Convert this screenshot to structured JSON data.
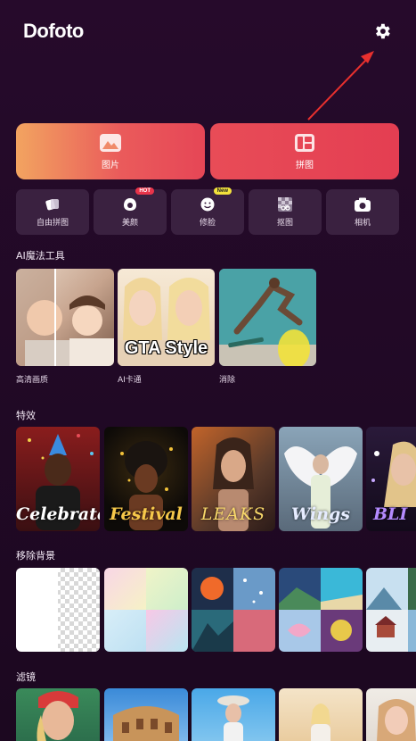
{
  "header": {
    "logo": "Dofoto",
    "settings_icon": "gear-icon"
  },
  "main_actions": [
    {
      "label": "图片",
      "icon": "image-icon"
    },
    {
      "label": "拼图",
      "icon": "collage-icon"
    }
  ],
  "tools": [
    {
      "label": "自由拼图",
      "icon": "free-collage-icon",
      "badge": ""
    },
    {
      "label": "美颜",
      "icon": "beauty-icon",
      "badge": "HOT"
    },
    {
      "label": "修脸",
      "icon": "face-icon",
      "badge": "New"
    },
    {
      "label": "抠图",
      "icon": "cutout-icon",
      "badge": ""
    },
    {
      "label": "相机",
      "icon": "camera-icon",
      "badge": ""
    }
  ],
  "ai_tools": {
    "title": "AI魔法工具",
    "items": [
      {
        "label": "高清画质"
      },
      {
        "label": "AI卡通",
        "overlay": "GTA Style"
      },
      {
        "label": "消除"
      }
    ]
  },
  "effects": {
    "title": "特效",
    "items": [
      {
        "overlay": "Celebrate"
      },
      {
        "overlay": "Festival"
      },
      {
        "overlay": "LEAKS"
      },
      {
        "overlay": "Wings"
      },
      {
        "overlay": "BLI"
      }
    ]
  },
  "remove_bg": {
    "title": "移除背景"
  },
  "filters": {
    "title": "滤镜"
  },
  "colors": {
    "accent": "#e84c57",
    "background": "#260a2b",
    "tile": "#3a2140"
  }
}
